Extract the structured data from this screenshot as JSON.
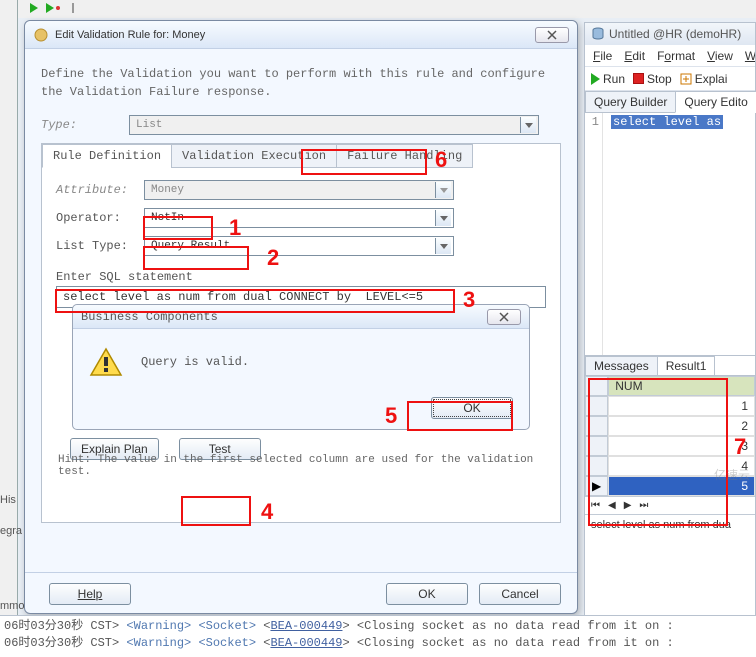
{
  "toolbar_hint_left": [
    "His",
    "egra",
    "mmon"
  ],
  "dialog": {
    "title": "Edit Validation Rule for: Money",
    "intro": "Define the Validation you want to perform with this rule and configure the Validation Failure response.",
    "type_label": "Type:",
    "type_value": "List",
    "tabs": {
      "definition": "Rule Definition",
      "execution": "Validation Execution",
      "failure": "Failure Handling"
    },
    "attribute_label": "Attribute:",
    "attribute_value": "Money",
    "operator_label": "Operator:",
    "operator_value": "NotIn",
    "listtype_label": "List Type:",
    "listtype_value": "Query Result",
    "sql_label": "Enter SQL statement",
    "sql_value": "select level as num from dual CONNECT by  LEVEL<=5",
    "explain_btn": "Explain Plan",
    "test_btn": "Test",
    "hint": "Hint: The value in the first selected column are used for the validation test.",
    "help_btn": "Help",
    "ok_btn": "OK",
    "cancel_btn": "Cancel"
  },
  "inner": {
    "title": "Business Components",
    "msg": "Query is valid.",
    "ok": "OK"
  },
  "annotations": {
    "n1": "1",
    "n2": "2",
    "n3": "3",
    "n4": "4",
    "n5": "5",
    "n6": "6",
    "n7": "7"
  },
  "right": {
    "title": "Untitled @HR (demoHR)",
    "menus": {
      "file": "File",
      "edit": "Edit",
      "format": "Format",
      "view": "View",
      "w": "W"
    },
    "run": "Run",
    "stop": "Stop",
    "explain": "Explai",
    "tabs": {
      "builder": "Query Builder",
      "editor": "Query Edito"
    },
    "code_line_no": "1",
    "code": "select level as",
    "msg_tabs": {
      "messages": "Messages",
      "result": "Result1"
    },
    "col": "NUM",
    "rows": [
      "1",
      "2",
      "3",
      "4",
      "5"
    ],
    "sql_display": "select level as num from dua"
  },
  "watermark": "亿速云",
  "console": {
    "line1_time": "06时03分30秒 CST>",
    "tag_warn": "<Warning>",
    "tag_sock": "<Socket>",
    "bea": "BEA-000449",
    "closing": "<Closing socket as no data read from it on :",
    "line2_time": "06时03分30秒 CST>"
  }
}
